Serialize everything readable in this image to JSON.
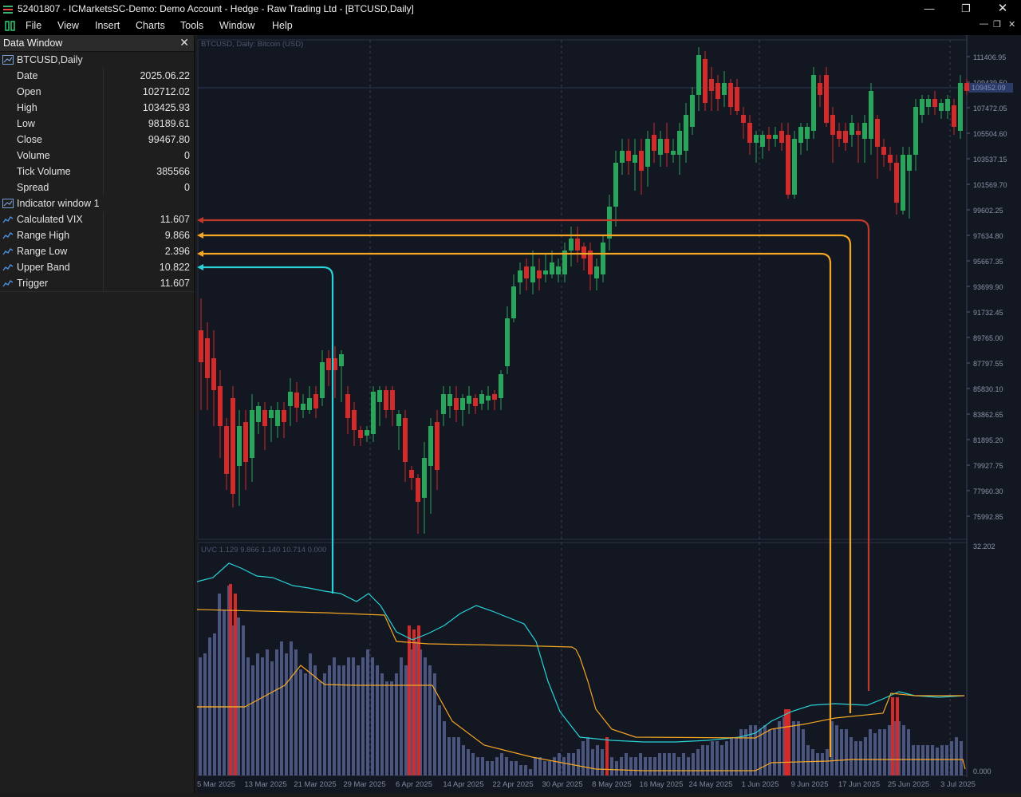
{
  "window": {
    "title": "52401807 - ICMarketsSC-Demo: Demo Account - Hedge - Raw Trading Ltd - [BTCUSD,Daily]"
  },
  "menu": [
    "File",
    "View",
    "Insert",
    "Charts",
    "Tools",
    "Window",
    "Help"
  ],
  "data_window": {
    "title": "Data Window",
    "symbol": "BTCUSD,Daily",
    "rows": [
      {
        "label": "Date",
        "value": "2025.06.22"
      },
      {
        "label": "Open",
        "value": "102712.02"
      },
      {
        "label": "High",
        "value": "103425.93"
      },
      {
        "label": "Low",
        "value": "98189.61"
      },
      {
        "label": "Close",
        "value": "99467.80"
      },
      {
        "label": "Volume",
        "value": "0"
      },
      {
        "label": "Tick Volume",
        "value": "385566"
      },
      {
        "label": "Spread",
        "value": "0"
      }
    ],
    "indicator_header": "Indicator window 1",
    "indicator_rows": [
      {
        "label": "Calculated VIX",
        "value": "11.607"
      },
      {
        "label": "Range High",
        "value": "9.866"
      },
      {
        "label": "Range Low",
        "value": "2.396"
      },
      {
        "label": "Upper Band",
        "value": "10.822"
      },
      {
        "label": "Trigger",
        "value": "11.607"
      }
    ]
  },
  "main_chart": {
    "label": "BTCUSD, Daily:  Bitcoin (USD)",
    "price_ticks": [
      "111406.95",
      "109439.50",
      "107472.05",
      "105504.60",
      "103537.15",
      "101569.70",
      "99602.25",
      "97634.80",
      "95667.35",
      "93699.90",
      "91732.45",
      "89765.00",
      "87797.55",
      "85830.10",
      "83862.65",
      "81895.20",
      "79927.75",
      "77960.30",
      "75992.85"
    ],
    "current_price": "109452.09"
  },
  "sub_chart": {
    "label": "UVC 1.129 9.866 1.140 10.714 0.000",
    "ticks": [
      "32.202",
      "0.000"
    ]
  },
  "date_ticks": [
    "5 Mar 2025",
    "13 Mar 2025",
    "21 Mar 2025",
    "29 Mar 2025",
    "6 Apr 2025",
    "14 Apr 2025",
    "22 Apr 2025",
    "30 Apr 2025",
    "8 May 2025",
    "16 May 2025",
    "24 May 2025",
    "1 Jun 2025",
    "9 Jun 2025",
    "17 Jun 2025",
    "25 Jun 2025",
    "3 Jul 2025"
  ],
  "colors": {
    "bull": "#26a65b",
    "bear": "#d42a2a",
    "vix": "#29d3d8",
    "band": "#f5a623",
    "hist": "#4b5680",
    "hist_hot": "#d42a2a",
    "arrow_red": "#c0392b",
    "arrow_orange": "#f5a623",
    "arrow_cyan": "#29d3d8"
  }
}
